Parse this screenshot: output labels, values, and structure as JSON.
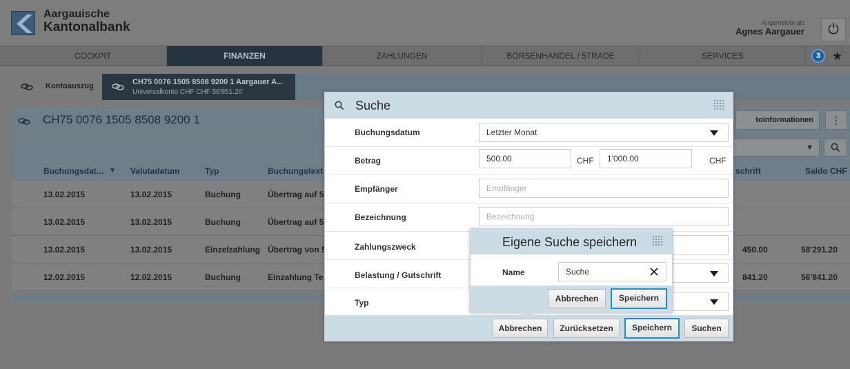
{
  "brand": {
    "line1": "Aargauische",
    "line2": "Kantonalbank"
  },
  "user": {
    "logged_in_label": "Angemeldet als",
    "name": "Agnes Aargauer"
  },
  "nav": {
    "items": [
      {
        "label": "COCKPIT"
      },
      {
        "label": "FINANZEN"
      },
      {
        "label": "ZAHLUNGEN"
      },
      {
        "label": "BÖRSENHANDEL / 5TRADE"
      },
      {
        "label": "SERVICES"
      }
    ],
    "badge_count": "3",
    "star_glyph": "★",
    "power_glyph": "⏻"
  },
  "breadcrumb": {
    "first": "Kontoauszug",
    "second_title": "CH75 0076 1505 8508 9200 1 Aargauer A...",
    "second_sub": "Universalkonto CHF CHF 56'851.20"
  },
  "account": {
    "iban": "CH75 0076 1505 8508 9200 1",
    "info_button": "toinformationen",
    "menu_glyph": "⋮"
  },
  "table": {
    "headers": [
      "Buchungsdat...",
      "Valutadatum",
      "Typ",
      "Buchungstext",
      "schrift",
      "Saldo CHF"
    ],
    "sort_glyph": "▼",
    "rows": [
      {
        "buchungsdatum": "13.02.2015",
        "valutadatum": "13.02.2015",
        "typ": "Buchung",
        "text": "Übertrag auf 5",
        "betrag": "",
        "saldo": ""
      },
      {
        "buchungsdatum": "13.02.2015",
        "valutadatum": "13.02.2015",
        "typ": "Buchung",
        "text": "Übertrag auf 5",
        "betrag": "",
        "saldo": ""
      },
      {
        "buchungsdatum": "13.02.2015",
        "valutadatum": "13.02.2015",
        "typ": "Einzelzahlung",
        "text": "Übertrag von 5",
        "betrag": "450.00",
        "saldo": "58'291.20"
      },
      {
        "buchungsdatum": "12.02.2015",
        "valutadatum": "12.02.2015",
        "typ": "Buchung",
        "text": "Einzahlung Te",
        "betrag": "841.20",
        "saldo": "56'841.20"
      }
    ]
  },
  "search_modal": {
    "title": "Suche",
    "fields": {
      "buchungsdatum": {
        "label": "Buchungsdatum",
        "value": "Letzter Monat"
      },
      "betrag": {
        "label": "Betrag",
        "from": "500.00",
        "to": "1'000.00",
        "unit": "CHF"
      },
      "empfaenger": {
        "label": "Empfänger",
        "placeholder": "Empfänger"
      },
      "bezeichnung": {
        "label": "Bezeichnung",
        "placeholder": "Bezeichnung"
      },
      "zahlungszweck": {
        "label": "Zahlungszweck",
        "value": ""
      },
      "belastung": {
        "label": "Belastung / Gutschrift",
        "value": ""
      },
      "typ": {
        "label": "Typ",
        "value": ""
      }
    },
    "buttons": {
      "cancel": "Abbrechen",
      "reset": "Zurücksetzen",
      "save": "Speichern",
      "search": "Suchen"
    }
  },
  "save_popup": {
    "title": "Eigene Suche speichern",
    "name_label": "Name",
    "name_value": "Suche",
    "clear_glyph": "✕",
    "buttons": {
      "cancel": "Abbrechen",
      "save": "Speichern"
    }
  },
  "colors": {
    "accent": "#1a8fd1",
    "modal_header": "#ccdce5",
    "nav_active": "#26343f",
    "brand_blue": "#3d5a78"
  },
  "icons": {
    "search": "search-icon",
    "drag": "drag-handle-icon",
    "coins": "coins-icon",
    "power": "power-icon",
    "star": "star-icon",
    "clear": "close-icon",
    "dropdown": "caret-down-icon"
  }
}
